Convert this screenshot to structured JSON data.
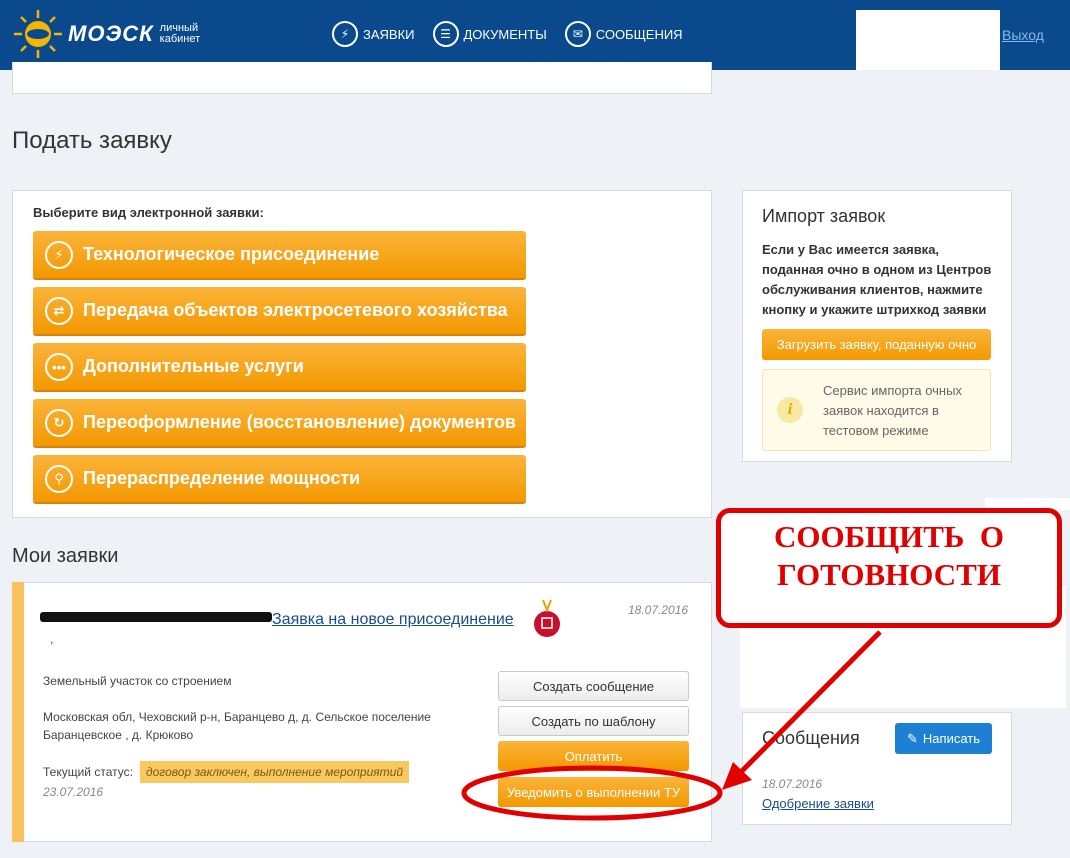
{
  "header": {
    "logo_text": "МОЭСК",
    "logo_sub1": "личный",
    "logo_sub2": "кабинет",
    "nav": [
      {
        "label": "ЗАЯВКИ",
        "icon": "lightning-icon"
      },
      {
        "label": "ДОКУМЕНТЫ",
        "icon": "document-icon"
      },
      {
        "label": "СООБЩЕНИЯ",
        "icon": "envelope-icon"
      }
    ],
    "logout": "Выход"
  },
  "submit": {
    "title": "Подать заявку",
    "prompt": "Выберите вид электронной заявки:",
    "options": [
      {
        "label": "Технологическое присоединение",
        "icon": "lightning-icon"
      },
      {
        "label": "Передача объектов электросетевого хозяйства",
        "icon": "transfer-icon"
      },
      {
        "label": "Дополнительные услуги",
        "icon": "more-icon"
      },
      {
        "label": "Переоформление (восстановление) документов",
        "icon": "refresh-icon"
      },
      {
        "label": "Перераспределение мощности",
        "icon": "plug-icon"
      }
    ]
  },
  "import": {
    "title": "Импорт заявок",
    "text": "Если у Вас имеется заявка, поданная очно в одном из Центров обслуживания клиентов, нажмите кнопку и укажите штрихкод заявки",
    "button": "Загрузить заявку, поданную очно",
    "notice": "Сервис импорта очных заявок находится в тестовом режиме"
  },
  "my_requests": {
    "title": "Мои заявки",
    "item": {
      "link": "Заявка на новое присоединение",
      "date": "18.07.2016",
      "comma": ",",
      "object": "Земельный участок со строением",
      "address": "Московская обл, Чеховский р-н, Баранцево д, д. Сельское поселение Баранцевское , д. Крюково",
      "status_label": "Текущий статус:",
      "status": "договор заключен, выполнение мероприятий",
      "status_date": "23.07.2016",
      "buttons": {
        "create_message": "Создать сообщение",
        "create_template": "Создать по шаблону",
        "pay": "Оплатить",
        "notify": "Уведомить о выполнении ТУ"
      }
    }
  },
  "messages": {
    "title": "Сообщения",
    "write": "Написать",
    "date": "18.07.2016",
    "link": "Одобрение заявки"
  },
  "annotation": {
    "line1": "СООБЩИТЬ  О",
    "line2": "ГОТОВНОСТИ"
  },
  "colors": {
    "header": "#0a4a8c",
    "orange": "#f39800",
    "annotation_red": "#e00000",
    "link_blue": "#1a4d8c"
  }
}
